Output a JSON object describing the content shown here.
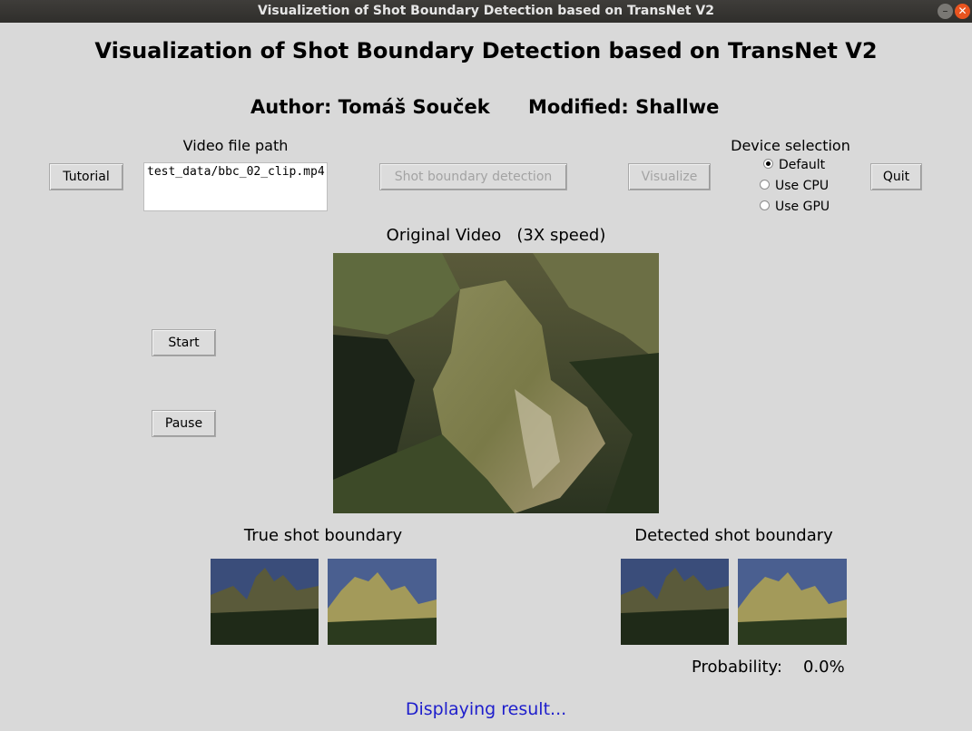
{
  "window": {
    "title": "Visualizetion of Shot Boundary Detection based on TransNet V2",
    "minimize_glyph": "–",
    "close_glyph": "✕"
  },
  "header": {
    "title": "Visualization of Shot Boundary Detection based on TransNet V2",
    "author": "Author: Tomáš Souček",
    "modified": "Modified: Shallwe"
  },
  "controls": {
    "video_path_label": "Video file path",
    "video_path_value": "test_data/bbc_02_clip.mp4",
    "tutorial_label": "Tutorial",
    "detect_label": "Shot boundary detection",
    "visualize_label": "Visualize",
    "quit_label": "Quit",
    "device_label": "Device selection",
    "device_options": [
      "Default",
      "Use CPU",
      "Use GPU"
    ],
    "device_selected": "Default"
  },
  "player": {
    "caption": "Original Video   (3X speed)",
    "start_label": "Start",
    "pause_label": "Pause"
  },
  "boundaries": {
    "true_label": "True shot boundary",
    "detected_label": "Detected shot boundary",
    "probability_label": "Probability:",
    "probability_value": "0.0%"
  },
  "status": "Displaying result...",
  "colors": {
    "status_text": "#1e1ecc",
    "titlebar": "#393734",
    "close_button": "#e9541f"
  }
}
